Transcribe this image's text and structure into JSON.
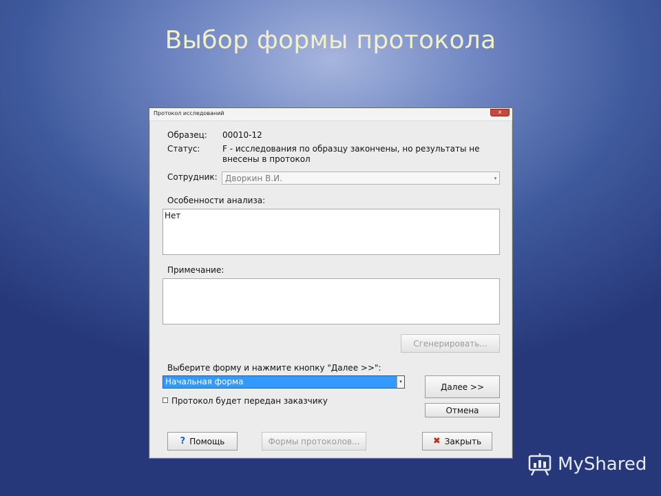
{
  "slide": {
    "title": "Выбор формы протокола"
  },
  "window": {
    "title": "Протокол исследований",
    "close_glyph": "x"
  },
  "form": {
    "sample_label": "Образец:",
    "sample_value": "00010-12",
    "status_label": "Статус:",
    "status_value": "F - исследования по образцу закончены, но результаты не внесены в протокол",
    "employee_label": "Сотрудник:",
    "employee_value": "Дворкин В.И.",
    "analysis_label": "Особенности анализа:",
    "analysis_value": "Нет",
    "note_label": "Примечание:",
    "note_value": "",
    "generate_label": "Сгенерировать...",
    "choose_label": "Выберите форму и нажмите кнопку \"Далее >>\":",
    "form_select_value": "Начальная форма",
    "next_label": "Далее >>",
    "cancel_label": "Отмена",
    "checkbox_label": "Протокол будет передан заказчику",
    "checkbox_checked": false
  },
  "footer": {
    "help_label": "Помощь",
    "forms_label": "Формы протоколов...",
    "close_label": "Закрыть"
  },
  "icons": {
    "help": "question-icon",
    "close": "x-icon",
    "logo": "presentation-board-icon"
  },
  "logo": {
    "text": "MyShared"
  }
}
